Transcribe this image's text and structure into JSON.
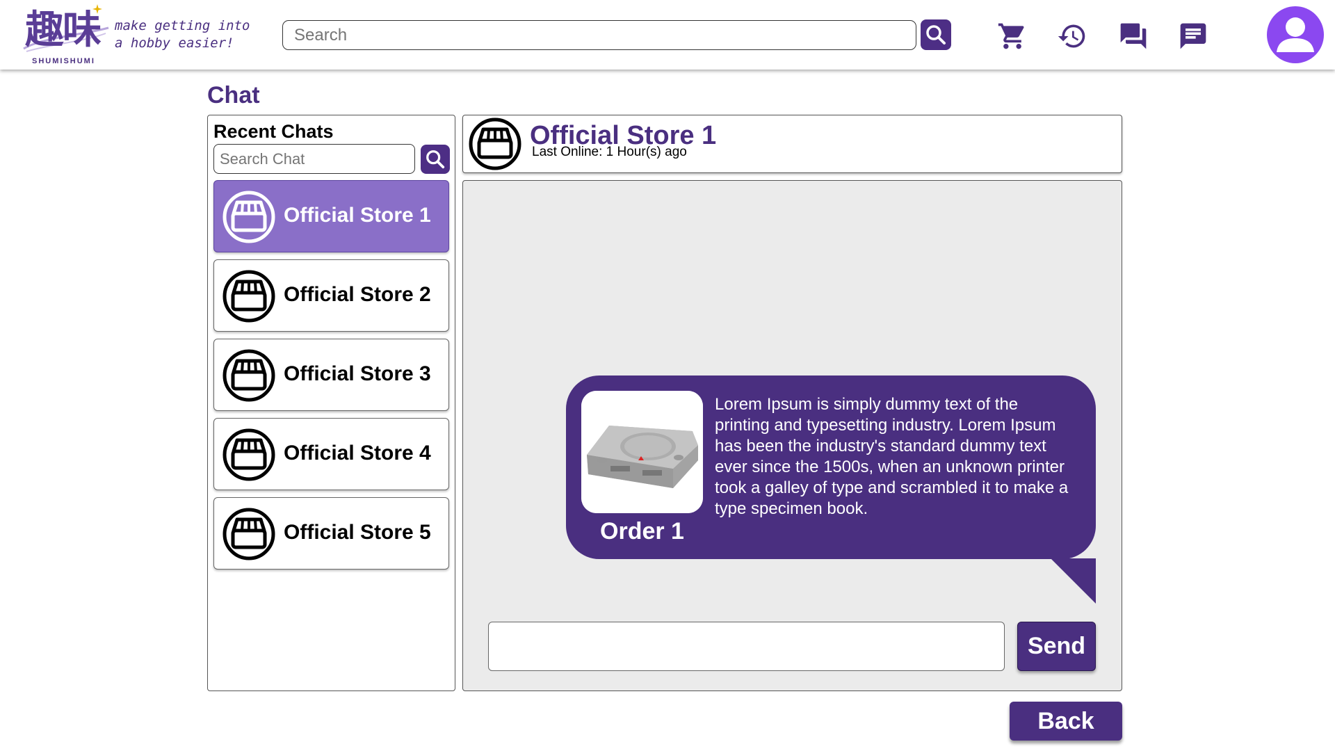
{
  "brand": {
    "logo_text": "趣味",
    "logo_subtext": "SHUMISHUMI",
    "tagline_line1": "make getting into",
    "tagline_line2": "a hobby easier!"
  },
  "header": {
    "search_placeholder": "Search",
    "icons": [
      "search-icon",
      "cart-icon",
      "history-icon",
      "forum-icon",
      "message-icon",
      "account-icon"
    ]
  },
  "page": {
    "title": "Chat"
  },
  "sidebar": {
    "title": "Recent Chats",
    "search_placeholder": "Search Chat",
    "items": [
      {
        "label": "Official Store 1",
        "active": true
      },
      {
        "label": "Official Store 2",
        "active": false
      },
      {
        "label": "Official Store 3",
        "active": false
      },
      {
        "label": "Official Store 4",
        "active": false
      },
      {
        "label": "Official Store 5",
        "active": false
      }
    ]
  },
  "chat": {
    "store_name": "Official Store 1",
    "status": "Last Online: 1 Hour(s) ago",
    "message": {
      "order_label": "Order 1",
      "text": "Lorem Ipsum is simply dummy text of the printing and typesetting industry. Lorem Ipsum has been the industry's standard dummy text ever since the 1500s, when an unknown printer took a galley of type and scrambled it to make a type specimen book."
    },
    "send_label": "Send"
  },
  "footer": {
    "back_label": "Back"
  },
  "colors": {
    "primary": "#4a2f80",
    "active_item": "#8a6fc8",
    "avatar": "#8b48f0",
    "chat_background": "#ebebeb"
  }
}
